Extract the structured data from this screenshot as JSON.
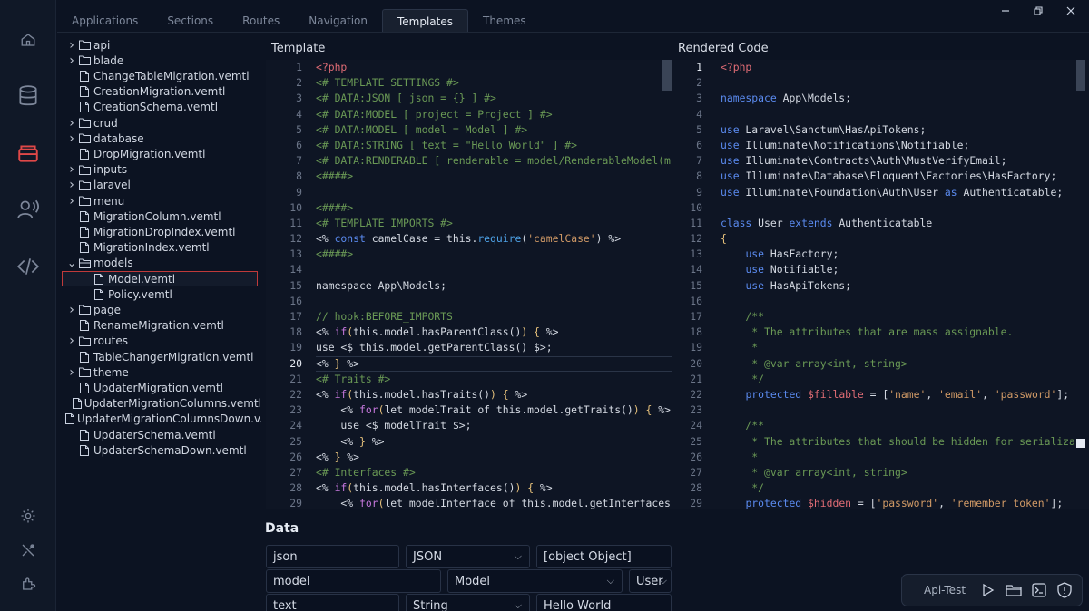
{
  "tabs": [
    "Applications",
    "Sections",
    "Routes",
    "Navigation",
    "Templates",
    "Themes"
  ],
  "active_tab": "Templates",
  "colors": {
    "accent": "#e04848",
    "selected_border": "#c03a3a",
    "editor_bg": "#0e1524"
  },
  "rail_icons": [
    "home-icon",
    "database-icon",
    "layers-icon",
    "user-voice-icon",
    "code-icon",
    "settings-icon",
    "tools-icon",
    "plugin-icon"
  ],
  "tree": [
    {
      "label": "api",
      "type": "folder",
      "depth": 0
    },
    {
      "label": "blade",
      "type": "folder",
      "depth": 0
    },
    {
      "label": "ChangeTableMigration.vemtl",
      "type": "file",
      "depth": 0
    },
    {
      "label": "CreationMigration.vemtl",
      "type": "file",
      "depth": 0
    },
    {
      "label": "CreationSchema.vemtl",
      "type": "file",
      "depth": 0
    },
    {
      "label": "crud",
      "type": "folder",
      "depth": 0
    },
    {
      "label": "database",
      "type": "folder",
      "depth": 0
    },
    {
      "label": "DropMigration.vemtl",
      "type": "file",
      "depth": 0
    },
    {
      "label": "inputs",
      "type": "folder",
      "depth": 0
    },
    {
      "label": "laravel",
      "type": "folder",
      "depth": 0
    },
    {
      "label": "menu",
      "type": "folder",
      "depth": 0
    },
    {
      "label": "MigrationColumn.vemtl",
      "type": "file",
      "depth": 0
    },
    {
      "label": "MigrationDropIndex.vemtl",
      "type": "file",
      "depth": 0
    },
    {
      "label": "MigrationIndex.vemtl",
      "type": "file",
      "depth": 0
    },
    {
      "label": "models",
      "type": "folder-open",
      "depth": 0
    },
    {
      "label": "Model.vemtl",
      "type": "file",
      "depth": 1,
      "selected": true
    },
    {
      "label": "Policy.vemtl",
      "type": "file",
      "depth": 1
    },
    {
      "label": "page",
      "type": "folder",
      "depth": 0
    },
    {
      "label": "RenameMigration.vemtl",
      "type": "file",
      "depth": 0
    },
    {
      "label": "routes",
      "type": "folder",
      "depth": 0
    },
    {
      "label": "TableChangerMigration.vemtl",
      "type": "file",
      "depth": 0
    },
    {
      "label": "theme",
      "type": "folder",
      "depth": 0
    },
    {
      "label": "UpdaterMigration.vemtl",
      "type": "file",
      "depth": 0
    },
    {
      "label": "UpdaterMigrationColumns.vemtl",
      "type": "file",
      "depth": 0
    },
    {
      "label": "UpdaterMigrationColumnsDown.v...",
      "type": "file",
      "depth": 0
    },
    {
      "label": "UpdaterSchema.vemtl",
      "type": "file",
      "depth": 0
    },
    {
      "label": "UpdaterSchemaDown.vemtl",
      "type": "file",
      "depth": 0
    }
  ],
  "template_panel": {
    "title": "Template",
    "current_line": 20,
    "lines": [
      [
        [
          "php",
          "<?php"
        ]
      ],
      [
        [
          "c",
          "<# TEMPLATE SETTINGS #>"
        ]
      ],
      [
        [
          "c",
          "<# DATA:JSON [ json = {} ] #>"
        ]
      ],
      [
        [
          "c",
          "<# DATA:MODEL [ project = Project ] #>"
        ]
      ],
      [
        [
          "c",
          "<# DATA:MODEL [ model = Model ] #>"
        ]
      ],
      [
        [
          "c",
          "<# DATA:STRING [ text = \"Hello World\" ] #>"
        ]
      ],
      [
        [
          "c",
          "<# DATA:RENDERABLE [ renderable = model/RenderableModel(m"
        ]
      ],
      [
        [
          "c",
          "<####>"
        ]
      ],
      [
        [
          "t",
          ""
        ]
      ],
      [
        [
          "c",
          "<####>"
        ]
      ],
      [
        [
          "c",
          "<# TEMPLATE IMPORTS #>"
        ]
      ],
      [
        [
          "t",
          "<% "
        ],
        [
          "kw",
          "const"
        ],
        [
          "t",
          " camelCase = this."
        ],
        [
          "f",
          "require"
        ],
        [
          "t",
          "("
        ],
        [
          "s",
          "'camelCase'"
        ],
        [
          "t",
          ") %>"
        ]
      ],
      [
        [
          "c",
          "<####>"
        ]
      ],
      [
        [
          "t",
          ""
        ]
      ],
      [
        [
          "t",
          "namespace App\\Models;"
        ]
      ],
      [
        [
          "t",
          ""
        ]
      ],
      [
        [
          "c",
          "// hook:BEFORE_IMPORTS"
        ]
      ],
      [
        [
          "t",
          "<% "
        ],
        [
          "k",
          "if"
        ],
        [
          "p",
          "("
        ],
        [
          "t",
          "this.model.hasParentClass()"
        ],
        [
          "p",
          ")"
        ],
        [
          "t",
          " "
        ],
        [
          "p",
          "{"
        ],
        [
          "t",
          " %>"
        ]
      ],
      [
        [
          "t",
          "use <$ this.model.getParentClass() $>;"
        ]
      ],
      [
        [
          "t",
          "<% "
        ],
        [
          "p",
          "}"
        ],
        [
          "t",
          " %>"
        ]
      ],
      [
        [
          "c",
          "<# Traits #>"
        ]
      ],
      [
        [
          "t",
          "<% "
        ],
        [
          "k",
          "if"
        ],
        [
          "p",
          "("
        ],
        [
          "t",
          "this.model.hasTraits()"
        ],
        [
          "p",
          ")"
        ],
        [
          "t",
          " "
        ],
        [
          "p",
          "{"
        ],
        [
          "t",
          " %>"
        ]
      ],
      [
        [
          "t",
          "    <% "
        ],
        [
          "k",
          "for"
        ],
        [
          "p",
          "("
        ],
        [
          "t",
          "let modelTrait of this.model.getTraits()"
        ],
        [
          "p",
          ")"
        ],
        [
          "t",
          " "
        ],
        [
          "p",
          "{"
        ],
        [
          "t",
          " %>"
        ]
      ],
      [
        [
          "t",
          "    use <$ modelTrait $>;"
        ]
      ],
      [
        [
          "t",
          "    <% "
        ],
        [
          "p",
          "}"
        ],
        [
          "t",
          " %>"
        ]
      ],
      [
        [
          "t",
          "<% "
        ],
        [
          "p",
          "}"
        ],
        [
          "t",
          " %>"
        ]
      ],
      [
        [
          "c",
          "<# Interfaces #>"
        ]
      ],
      [
        [
          "t",
          "<% "
        ],
        [
          "k",
          "if"
        ],
        [
          "p",
          "("
        ],
        [
          "t",
          "this.model.hasInterfaces()"
        ],
        [
          "p",
          ")"
        ],
        [
          "t",
          " "
        ],
        [
          "p",
          "{"
        ],
        [
          "t",
          " %>"
        ]
      ],
      [
        [
          "t",
          "    <% "
        ],
        [
          "k",
          "for"
        ],
        [
          "p",
          "("
        ],
        [
          "t",
          "let modelInterface of this.model.getInterfaces"
        ]
      ]
    ]
  },
  "rendered_panel": {
    "title": "Rendered Code",
    "current_line": 1,
    "lines": [
      [
        [
          "php",
          "<?php"
        ]
      ],
      [
        [
          "t",
          ""
        ]
      ],
      [
        [
          "kw",
          "namespace"
        ],
        [
          "t",
          " App\\Models;"
        ]
      ],
      [
        [
          "t",
          ""
        ]
      ],
      [
        [
          "kw",
          "use"
        ],
        [
          "t",
          " Laravel\\Sanctum\\HasApiTokens;"
        ]
      ],
      [
        [
          "kw",
          "use"
        ],
        [
          "t",
          " Illuminate\\Notifications\\Notifiable;"
        ]
      ],
      [
        [
          "kw",
          "use"
        ],
        [
          "t",
          " Illuminate\\Contracts\\Auth\\MustVerifyEmail;"
        ]
      ],
      [
        [
          "kw",
          "use"
        ],
        [
          "t",
          " Illuminate\\Database\\Eloquent\\Factories\\HasFactory;"
        ]
      ],
      [
        [
          "kw",
          "use"
        ],
        [
          "t",
          " Illuminate\\Foundation\\Auth\\User "
        ],
        [
          "kw",
          "as"
        ],
        [
          "t",
          " Authenticatable;"
        ]
      ],
      [
        [
          "t",
          ""
        ]
      ],
      [
        [
          "kw",
          "class"
        ],
        [
          "t",
          " User "
        ],
        [
          "kw",
          "extends"
        ],
        [
          "t",
          " Authenticatable"
        ]
      ],
      [
        [
          "p",
          "{"
        ]
      ],
      [
        [
          "t",
          "    "
        ],
        [
          "kw",
          "use"
        ],
        [
          "t",
          " HasFactory;"
        ]
      ],
      [
        [
          "t",
          "    "
        ],
        [
          "kw",
          "use"
        ],
        [
          "t",
          " Notifiable;"
        ]
      ],
      [
        [
          "t",
          "    "
        ],
        [
          "kw",
          "use"
        ],
        [
          "t",
          " HasApiTokens;"
        ]
      ],
      [
        [
          "t",
          ""
        ]
      ],
      [
        [
          "c",
          "    /**"
        ]
      ],
      [
        [
          "c",
          "     * The attributes that are mass assignable."
        ]
      ],
      [
        [
          "c",
          "     *"
        ]
      ],
      [
        [
          "c",
          "     * @var array<int, string>"
        ]
      ],
      [
        [
          "c",
          "     */"
        ]
      ],
      [
        [
          "t",
          "    "
        ],
        [
          "kw",
          "protected"
        ],
        [
          "t",
          " "
        ],
        [
          "v",
          "$fillable"
        ],
        [
          "t",
          " = ["
        ],
        [
          "s",
          "'name'"
        ],
        [
          "t",
          ", "
        ],
        [
          "s",
          "'email'"
        ],
        [
          "t",
          ", "
        ],
        [
          "s",
          "'password'"
        ],
        [
          "t",
          "];"
        ]
      ],
      [
        [
          "t",
          ""
        ]
      ],
      [
        [
          "c",
          "    /**"
        ]
      ],
      [
        [
          "c",
          "     * The attributes that should be hidden for serializa"
        ]
      ],
      [
        [
          "c",
          "     *"
        ]
      ],
      [
        [
          "c",
          "     * @var array<int, string>"
        ]
      ],
      [
        [
          "c",
          "     */"
        ]
      ],
      [
        [
          "t",
          "    "
        ],
        [
          "kw",
          "protected"
        ],
        [
          "t",
          " "
        ],
        [
          "v",
          "$hidden"
        ],
        [
          "t",
          " = ["
        ],
        [
          "s",
          "'password'"
        ],
        [
          "t",
          ", "
        ],
        [
          "s",
          "'remember_token'"
        ],
        [
          "t",
          "];"
        ]
      ]
    ]
  },
  "data_section": {
    "title": "Data",
    "rows": [
      {
        "name": "json",
        "type": "JSON",
        "value": "[object Object]"
      },
      {
        "name": "model",
        "type": "Model",
        "value": "User"
      },
      {
        "name": "text",
        "type": "String",
        "value": "Hello World"
      }
    ]
  },
  "api_test": {
    "label": "Api-Test",
    "buttons": [
      "play-icon",
      "folder-icon",
      "terminal-icon",
      "shield-icon"
    ]
  },
  "window_controls": [
    "minimize-icon",
    "maximize-icon",
    "close-icon"
  ]
}
